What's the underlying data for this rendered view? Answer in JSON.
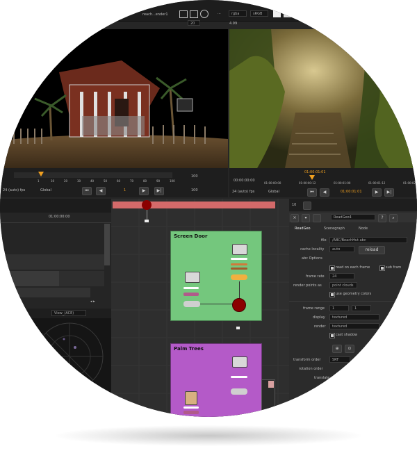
{
  "top_bar": {
    "left_field": "20",
    "right_field_1": "rgba",
    "right_field_2": "sRGB",
    "right_field_3": "4.99",
    "left_partial_label": "reach...ender1"
  },
  "timeline_left": {
    "fps": "24 (auto) fps",
    "mode": "Global",
    "frame": "1",
    "end": "100",
    "end2": "100",
    "ticks": [
      "1",
      "10",
      "20",
      "30",
      "40",
      "50",
      "60",
      "70",
      "80",
      "90",
      "100"
    ]
  },
  "timeline_right": {
    "time": "00:00:00:00",
    "fps": "24 (auto) fps",
    "mode": "Global",
    "timecode": "01:00:01:01",
    "tick_top": "01:00:01:01",
    "ticks": [
      "01:00:00:00",
      "01:00:00:12",
      "01:00:01:00",
      "01:00:01:12",
      "01:00:02:00"
    ]
  },
  "left_panel": {
    "timecode": "01:00:00:00",
    "timecode2": "01:00:00:00",
    "view_label": "View_(ACE)"
  },
  "node_graph": {
    "backdrop_1": {
      "title": "Screen Door",
      "color": "#74c77d"
    },
    "backdrop_2": {
      "title": "Palm Trees",
      "color": "#b45ac8"
    }
  },
  "properties": {
    "node_name": "ReadGeo4",
    "tabs": [
      "ReadGeo",
      "Scenegraph",
      "Node"
    ],
    "file_label": "file",
    "file_value": "/ABC/BeachHut.abc",
    "cache_label": "cache locality",
    "cache_value": "auto",
    "reload_label": "reload",
    "abc_options_label": "abc Options",
    "read_each_frame": "read on each frame",
    "sub_frame": "sub fram",
    "frame_rate_label": "frame rate",
    "frame_rate_value": "24",
    "render_points_label": "render points as",
    "render_points_value": "point clouds",
    "use_geometry_colors": "use geometry colors",
    "frame_range_label": "frame range",
    "frame_range_start": "1",
    "frame_range_end": "1",
    "display_label": "display",
    "display_value": "textured",
    "render_label": "render",
    "render_value": "textured",
    "cast_shadow": "cast shadow",
    "transform_order_label": "transform order",
    "transform_order_value": "SRT",
    "rotation_order_label": "rotation order",
    "translate_label": "translate"
  },
  "colors": {
    "accent_orange": "#f0a020",
    "viewer_range_red": "#d46a6a",
    "node_red": "#8b0000"
  }
}
